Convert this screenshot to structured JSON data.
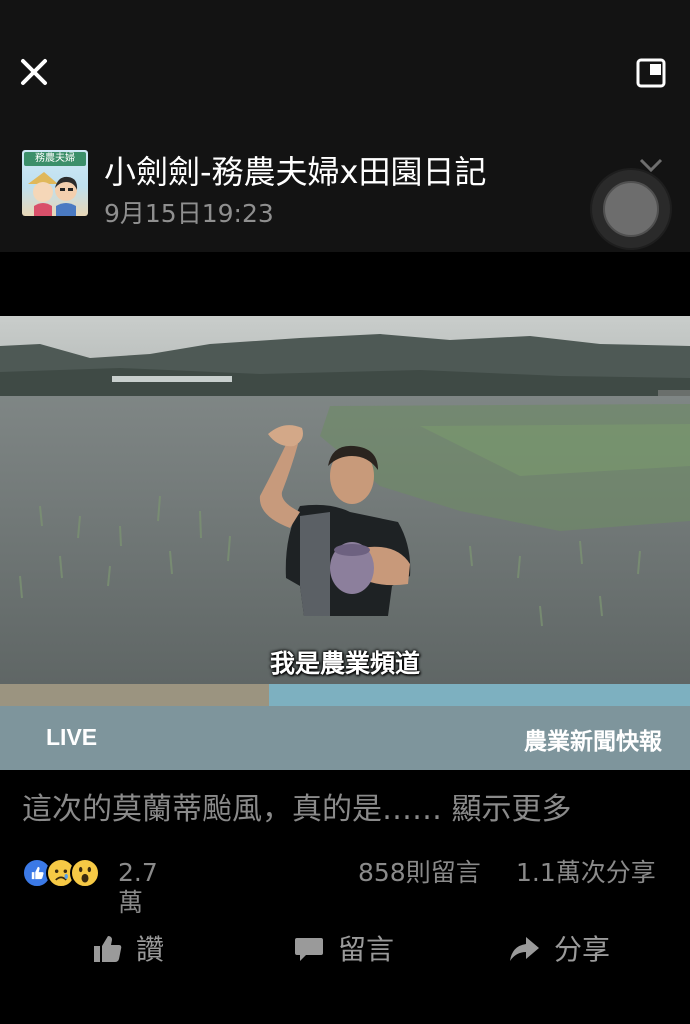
{
  "header": {
    "page_name": "小劍劍-務農夫婦x田園日記",
    "timestamp": "9月15日19:23",
    "avatar_text": "務農夫婦"
  },
  "video": {
    "subtitle": "我是農業頻道",
    "live_label": "LIVE",
    "program_label": "農業新聞快報",
    "progress": 0.39
  },
  "post": {
    "caption": "這次的莫蘭蒂颱風，真的是……",
    "see_more": "顯示更多"
  },
  "stats": {
    "reaction_count": "2.7萬",
    "comments": "858則留言",
    "shares": "1.1萬次分享"
  },
  "actions": {
    "like": "讚",
    "comment": "留言",
    "share": "分享"
  },
  "colors": {
    "background": "#000000",
    "header_bg": "#131313",
    "muted_text": "#8a8a8a",
    "like_blue": "#3b79e6",
    "reaction_yellow": "#f6c945"
  },
  "icons": [
    "close-icon",
    "pip-icon",
    "chevron-down-icon",
    "like-icon",
    "comment-icon",
    "share-icon"
  ]
}
